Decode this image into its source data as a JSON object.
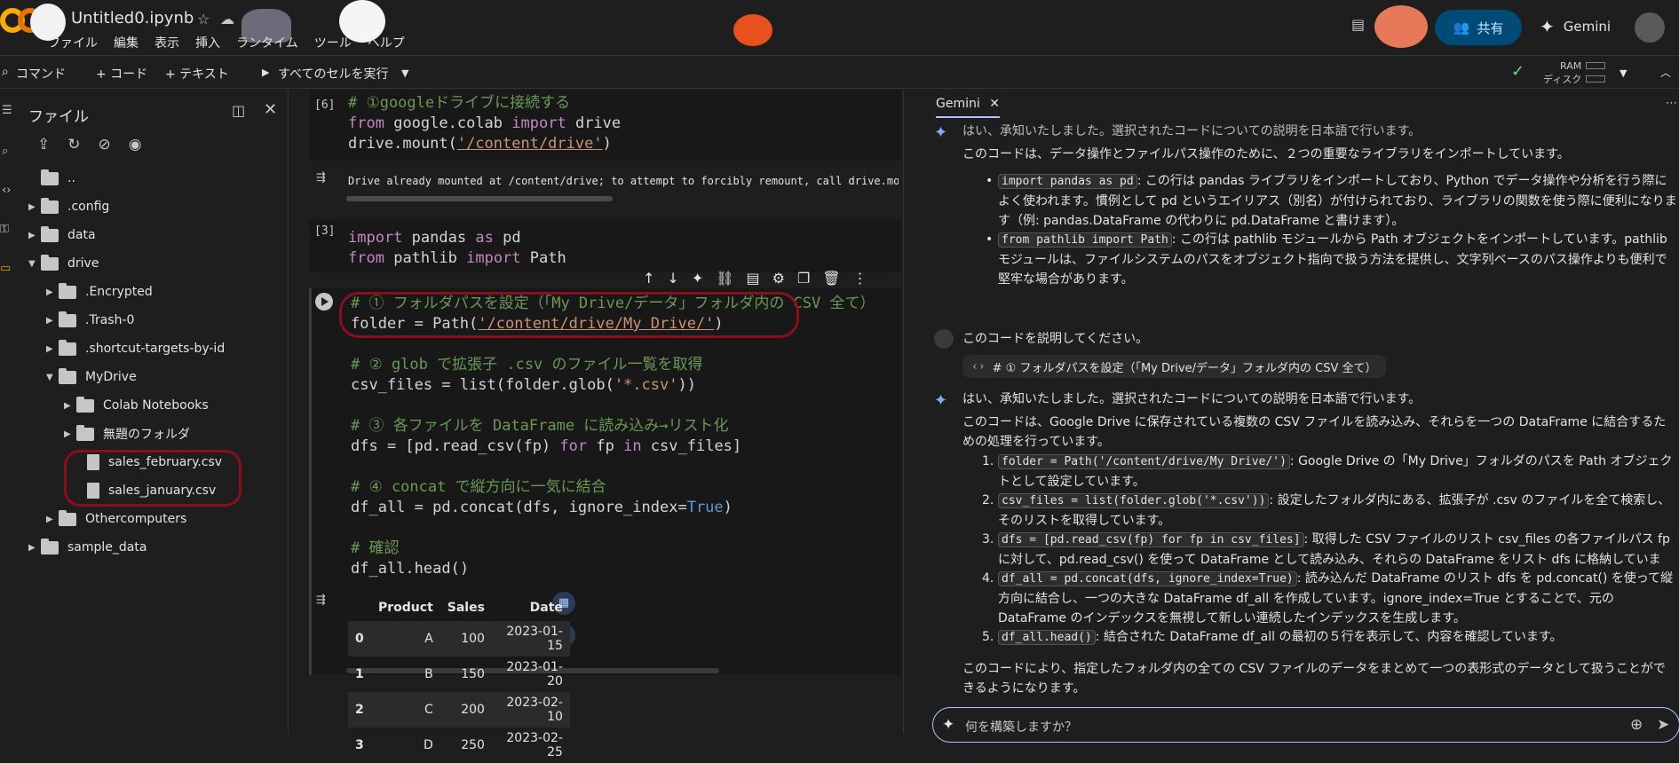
{
  "header": {
    "title": "Untitled0.ipynb",
    "menu": [
      "ファイル",
      "編集",
      "表示",
      "挿入",
      "ランタイム",
      "ツール",
      "ヘルプ"
    ],
    "share_label": "共有",
    "gemini_label": "Gemini"
  },
  "toolbar": {
    "command": "コマンド",
    "add_code": "+ コード",
    "add_text": "+ テキスト",
    "run_all": "すべてのセルを実行",
    "ram": "RAM",
    "disk": "ディスク"
  },
  "sidebar": {
    "title": "ファイル",
    "tree": [
      {
        "label": "..",
        "kind": "folder"
      },
      {
        "label": ".config",
        "kind": "folder"
      },
      {
        "label": "data",
        "kind": "folder"
      },
      {
        "label": "drive",
        "kind": "folder"
      },
      {
        "label": ".Encrypted",
        "kind": "folder"
      },
      {
        "label": ".Trash-0",
        "kind": "folder"
      },
      {
        "label": ".shortcut-targets-by-id",
        "kind": "folder"
      },
      {
        "label": "MyDrive",
        "kind": "folder"
      },
      {
        "label": "Colab Notebooks",
        "kind": "folder"
      },
      {
        "label": "無題のフォルダ",
        "kind": "folder"
      },
      {
        "label": "sales_february.csv",
        "kind": "file"
      },
      {
        "label": "sales_january.csv",
        "kind": "file"
      },
      {
        "label": "Othercomputers",
        "kind": "folder"
      },
      {
        "label": "sample_data",
        "kind": "folder"
      }
    ]
  },
  "notebook": {
    "cell1": {
      "number": "[6]",
      "lines": [
        "# ①googleドライブに接続する",
        "from google.colab import drive",
        "drive.mount('/content/drive')"
      ],
      "output": "Drive already mounted at /content/drive; to attempt to forcibly remount, call drive.mount"
    },
    "cell2": {
      "number": "[3]",
      "lines": [
        "import pandas as pd",
        "from pathlib import Path"
      ]
    },
    "cell3": {
      "lines": [
        "# ① フォルダパスを設定（「My Drive/データ」フォルダ内の CSV 全て）",
        "folder = Path('/content/drive/My Drive/')",
        "",
        "# ② glob で拡張子 .csv のファイル一覧を取得",
        "csv_files = list(folder.glob('*.csv'))",
        "",
        "# ③ 各ファイルを DataFrame に読み込み→リスト化",
        "dfs = [pd.read_csv(fp) for fp in csv_files]",
        "",
        "# ④ concat で縦方向に一気に結合",
        "df_all = pd.concat(dfs, ignore_index=True)",
        "",
        "# 確認",
        "df_all.head()"
      ]
    },
    "dataframe": {
      "columns": [
        "",
        "Product",
        "Sales",
        "Date"
      ],
      "rows": [
        [
          "0",
          "A",
          "100",
          "2023-01-15"
        ],
        [
          "1",
          "B",
          "150",
          "2023-01-20"
        ],
        [
          "2",
          "C",
          "200",
          "2023-02-10"
        ],
        [
          "3",
          "D",
          "250",
          "2023-02-25"
        ]
      ]
    }
  },
  "gemini": {
    "tab": "Gemini",
    "top_partial": "はい、承知いたしました。選択されたコードについての説明を日本語で行います。",
    "intro1": "このコードは、データ操作とファイルパス操作のために、２つの重要なライブラリをインポートしています。",
    "bullet1_code": "import pandas as pd",
    "bullet1_text": ": この行は pandas ライブラリをインポートしており、Python でデータ操作や分析を行う際によく使われます。慣例として pd というエイリアス（別名）が付けられており、ライブラリの関数を使う際に便利になります（例: pandas.DataFrame の代わりに pd.DataFrame と書けます）。",
    "bullet2_code": "from pathlib import Path",
    "bullet2_text": ": この行は pathlib モジュールから Path オブジェクトをインポートしています。pathlib モジュールは、ファイルシステムのパスをオブジェクト指向で扱う方法を提供し、文字列ベースのパス操作よりも便利で堅牢な場合があります。",
    "user_msg": "このコードを説明してください。",
    "code_chip": "# ① フォルダパスを設定（「My Drive/データ」フォルダ内の CSV 全て）",
    "reply_head": "はい、承知いたしました。選択されたコードについての説明を日本語で行います。",
    "reply_intro": "このコードは、Google Drive に保存されている複数の CSV ファイルを読み込み、それらを一つの DataFrame に結合するための処理を行っています。",
    "items": [
      {
        "code": "folder = Path('/content/drive/My Drive/')",
        "text": ": Google Drive の「My Drive」フォルダのパスを Path オブジェクトとして設定しています。"
      },
      {
        "code": "csv_files = list(folder.glob('*.csv'))",
        "text": ": 設定したフォルダ内にある、拡張子が .csv のファイルを全て検索し、そのリストを取得しています。"
      },
      {
        "code": "dfs = [pd.read_csv(fp) for fp in csv_files]",
        "text": ": 取得した CSV ファイルのリスト csv_files の各ファイルパス fp に対して、pd.read_csv() を使って DataFrame として読み込み、それらの DataFrame をリスト dfs に格納しています。"
      },
      {
        "code": "df_all = pd.concat(dfs, ignore_index=True)",
        "text": ": 読み込んだ DataFrame のリスト dfs を pd.concat() を使って縦方向に結合し、一つの大きな DataFrame df_all を作成しています。ignore_index=True とすることで、元の DataFrame のインデックスを無視して新しい連続したインデックスを生成します。"
      },
      {
        "code": "df_all.head()",
        "text": ": 結合された DataFrame df_all の最初の５行を表示して、内容を確認しています。"
      }
    ],
    "conclusion": "このコードにより、指定したフォルダ内の全ての CSV ファイルのデータをまとめて一つの表形式のデータとして扱うことができるようになります。",
    "prompt_placeholder": "何を構築しますか？"
  }
}
